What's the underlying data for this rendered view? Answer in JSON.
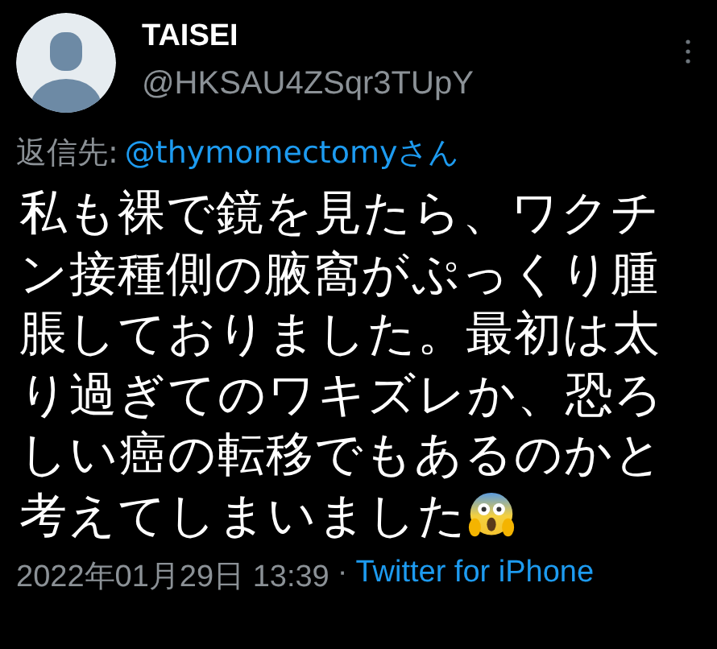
{
  "author": {
    "name": "TAISEI",
    "handle": "@HKSAU4ZSqr3TUpY"
  },
  "reply_to": {
    "prefix": "返信先:",
    "mention": "@thymomectomyさん"
  },
  "body_lines": [
    "私も裸で鏡を見たら、ワクチ",
    "ン接種側の腋窩がぷっくり腫",
    "脹しておりました。最初は太",
    "り過ぎてのワキズレか、恐ろ",
    "しい癌の転移でもあるのかと",
    "考えてしまいました"
  ],
  "footer": {
    "timestamp": "2022年01月29日 13:39",
    "separator": "·",
    "source": "Twitter for iPhone"
  }
}
